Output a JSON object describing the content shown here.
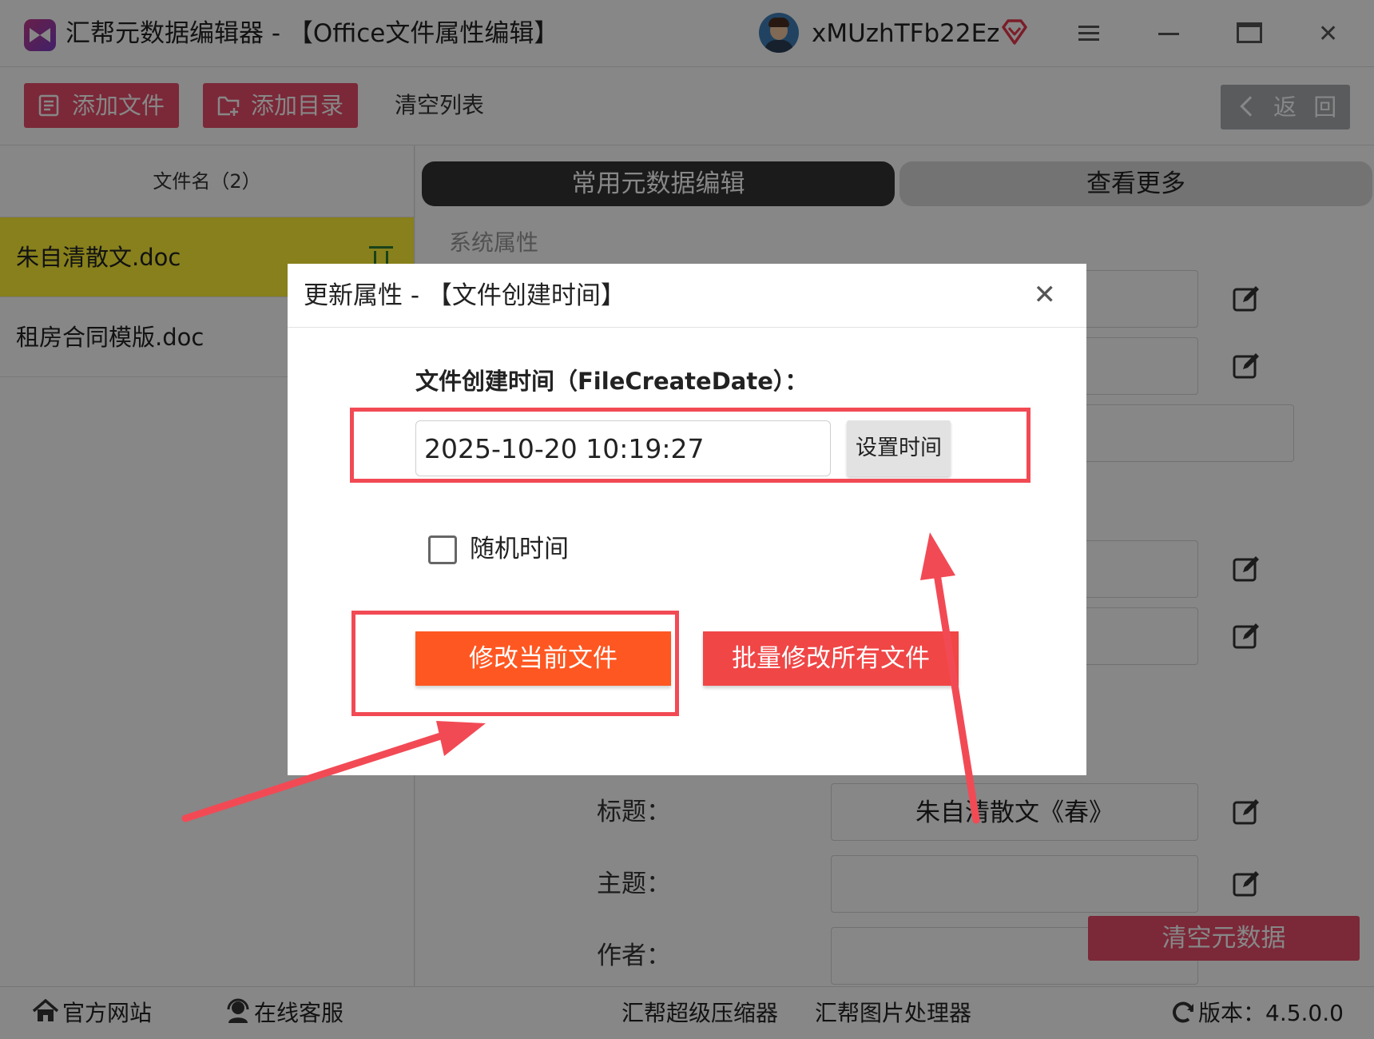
{
  "window": {
    "title": "汇帮元数据编辑器 - 【Office文件属性编辑】",
    "username": "xMUzhTFb22Ez"
  },
  "toolbar": {
    "add_file": "添加文件",
    "add_dir": "添加目录",
    "clear_list": "清空列表",
    "back": "返 回"
  },
  "file_list": {
    "header": "文件名（2）",
    "items": [
      {
        "name": "朱自清散文.doc",
        "selected": true
      },
      {
        "name": "租房合同模版.doc",
        "selected": false
      }
    ]
  },
  "editor": {
    "tabs": [
      "常用元数据编辑",
      "查看更多"
    ],
    "section_system": "系统属性",
    "fields": [
      {
        "label": "标题：",
        "value": "朱自清散文《春》"
      },
      {
        "label": "主题：",
        "value": ""
      },
      {
        "label": "作者：",
        "value": ""
      }
    ],
    "clear_metadata": "清空元数据"
  },
  "statusbar": {
    "website": "官方网站",
    "support": "在线客服",
    "compressor": "汇帮超级压缩器",
    "image_tool": "汇帮图片处理器",
    "version": "版本：4.5.0.0"
  },
  "dialog": {
    "title": "更新属性 - 【文件创建时间】",
    "field_label": "文件创建时间（FileCreateDate）：",
    "field_value": "2025-10-20 10:19:27",
    "set_time": "设置时间",
    "random_time": "随机时间",
    "random_checked": false,
    "modify_current": "修改当前文件",
    "modify_all": "批量修改所有文件"
  },
  "colors": {
    "accent_pink": "#e94d6b",
    "selected_row": "#fff136",
    "primary_orange": "#ff5722",
    "batch_red": "#f04646",
    "annotation_red": "#f24a55"
  }
}
